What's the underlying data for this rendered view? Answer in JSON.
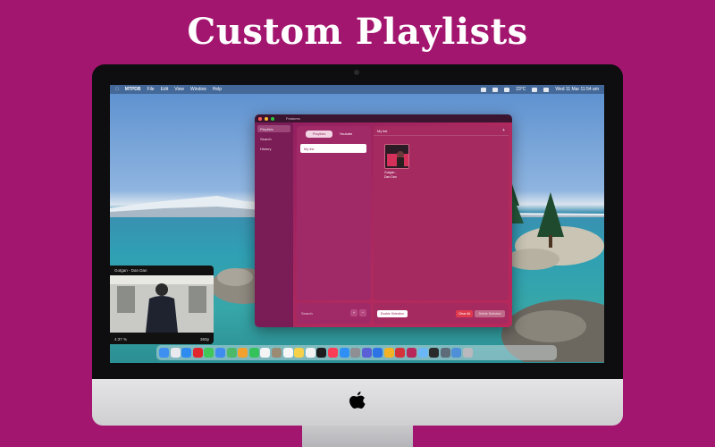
{
  "headline": "Custom Playlists",
  "menubar": {
    "app": "MTPDB",
    "items": [
      "File",
      "Edit",
      "View",
      "Window",
      "Help"
    ],
    "temperature": "23°C",
    "clock": "Wed 11 Mar 11:54 am"
  },
  "window": {
    "title": "Features",
    "sidebar": [
      "Playlists",
      "Search",
      "History"
    ],
    "segments": [
      "Playlists",
      "Youtube"
    ],
    "playlists": [
      "My list"
    ],
    "detail_header": "My list",
    "add_label": "+",
    "track_title": "Gotgan -\nDan Dan",
    "search_label": "Search",
    "stepper": [
      "+",
      "−"
    ],
    "enable_selection": "Enable Selection",
    "clear_all": "Clear All",
    "delete_selected": "Delete Selected"
  },
  "pip": {
    "title": "Gotgan - Dan Dan",
    "elapsed": "4:37 %",
    "quality": "360p"
  },
  "colors": {
    "background": "#a3166f",
    "window": "#a42a5f",
    "clear_button": "#e03a4e"
  },
  "dock_icons": [
    "finder-icon",
    "launchpad-icon",
    "safari-icon",
    "opera-icon",
    "messages-icon",
    "mail-icon",
    "maps-icon",
    "photos-icon",
    "facetime-icon",
    "calendar-icon",
    "contacts-icon",
    "reminders-icon",
    "notes-icon",
    "freeform-icon",
    "appletv-icon",
    "music-icon",
    "appstore-icon",
    "settings-icon",
    "text-icon",
    "xcode-icon",
    "sketch-icon",
    "vpn-icon",
    "mtpdb-icon",
    "preview-icon",
    "terminal-icon",
    "app-icon",
    "downloads-icon",
    "trash-icon"
  ]
}
